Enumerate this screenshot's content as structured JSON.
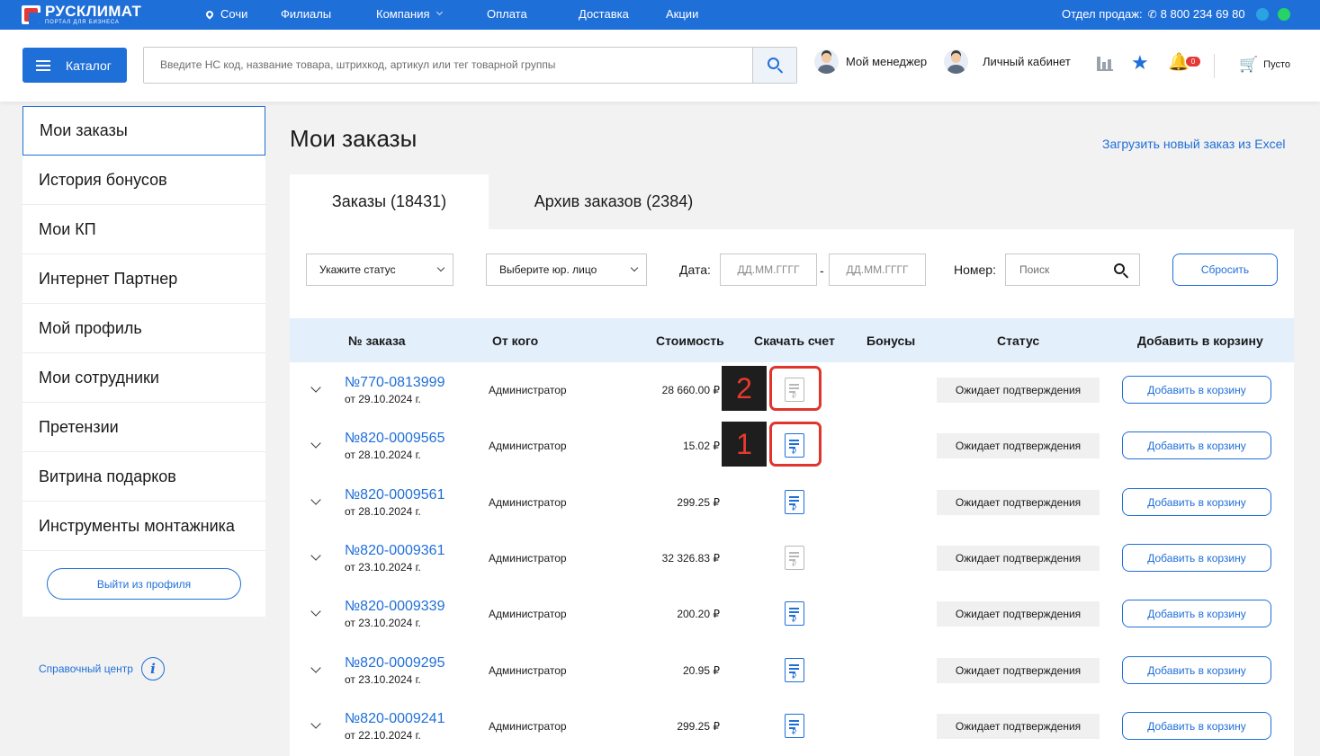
{
  "topbar": {
    "logo_name": "РУСКЛИМАТ",
    "logo_sub": "ПОРТАЛ ДЛЯ БИЗНЕСА",
    "city": "Сочи",
    "nav": [
      "Филиалы",
      "Компания",
      "Оплата",
      "Доставка",
      "Акции"
    ],
    "sales_label": "Отдел продаж:",
    "phone": "8 800 234 69 80",
    "colors": {
      "bar": "#1f6fd9",
      "telegram": "#2aa3e0",
      "whatsapp": "#25d366"
    }
  },
  "header": {
    "catalog_label": "Каталог",
    "search_placeholder": "Введите НС код, название товара, штрихкод, артикул или тег товарной группы",
    "manager_label": "Мой менеджер",
    "cabinet_label": "Личный кабинет",
    "notifications_count": "0",
    "cart_label": "Пусто",
    "icons": [
      "search-icon",
      "chart-icon",
      "star-icon",
      "bell-icon",
      "cart-icon"
    ]
  },
  "sidebar": {
    "items": [
      "Мои заказы",
      "История бонусов",
      "Мои КП",
      "Интернет Партнер",
      "Мой профиль",
      "Мои сотрудники",
      "Претензии",
      "Витрина подарков",
      "Инструменты монтажника"
    ],
    "logout_label": "Выйти из профиля",
    "help_label": "Справочный центр",
    "help_icon": "i"
  },
  "main": {
    "title": "Мои заказы",
    "excel_link": "Загрузить новый заказ из Excel",
    "tabs": [
      "Заказы (18431)",
      "Архив заказов (2384)"
    ],
    "filters": {
      "status_placeholder": "Укажите статус",
      "entity_placeholder": "Выберите юр. лицо",
      "date_label": "Дата:",
      "date_from": "ДД.ММ.ГГГГ",
      "date_sep": "-",
      "date_to": "ДД.ММ.ГГГГ",
      "number_label": "Номер:",
      "number_placeholder": "Поиск",
      "reset_label": "Сбросить"
    },
    "columns": [
      "№ заказа",
      "От кого",
      "Стоимость",
      "Скачать счет",
      "Бонусы",
      "Статус",
      "Добавить в корзину"
    ],
    "orders": [
      {
        "number": "№770-0813999",
        "date": "от 29.10.2024 г.",
        "from": "Администратор",
        "cost": "28 660.00 ₽",
        "invoice_available": false,
        "bonus": "",
        "status": "Ожидает подтверждения",
        "add_label": "Добавить в корзину"
      },
      {
        "number": "№820-0009565",
        "date": "от 28.10.2024 г.",
        "from": "Администратор",
        "cost": "15.02 ₽",
        "invoice_available": true,
        "bonus": "",
        "status": "Ожидает подтверждения",
        "add_label": "Добавить в корзину"
      },
      {
        "number": "№820-0009561",
        "date": "от 28.10.2024 г.",
        "from": "Администратор",
        "cost": "299.25 ₽",
        "invoice_available": true,
        "bonus": "",
        "status": "Ожидает подтверждения",
        "add_label": "Добавить в корзину"
      },
      {
        "number": "№820-0009361",
        "date": "от 23.10.2024 г.",
        "from": "Администратор",
        "cost": "32 326.83 ₽",
        "invoice_available": false,
        "bonus": "",
        "status": "Ожидает подтверждения",
        "add_label": "Добавить в корзину"
      },
      {
        "number": "№820-0009339",
        "date": "от 23.10.2024 г.",
        "from": "Администратор",
        "cost": "200.20 ₽",
        "invoice_available": true,
        "bonus": "",
        "status": "Ожидает подтверждения",
        "add_label": "Добавить в корзину"
      },
      {
        "number": "№820-0009295",
        "date": "от 23.10.2024 г.",
        "from": "Администратор",
        "cost": "20.95 ₽",
        "invoice_available": true,
        "bonus": "",
        "status": "Ожидает подтверждения",
        "add_label": "Добавить в корзину"
      },
      {
        "number": "№820-0009241",
        "date": "от 22.10.2024 г.",
        "from": "Администратор",
        "cost": "299.25 ₽",
        "invoice_available": true,
        "bonus": "",
        "status": "Ожидает подтверждения",
        "add_label": "Добавить в корзину"
      }
    ],
    "invoice_icon_glyph": "₽"
  },
  "annotations": [
    {
      "label": "2",
      "row": 0
    },
    {
      "label": "1",
      "row": 1
    }
  ]
}
